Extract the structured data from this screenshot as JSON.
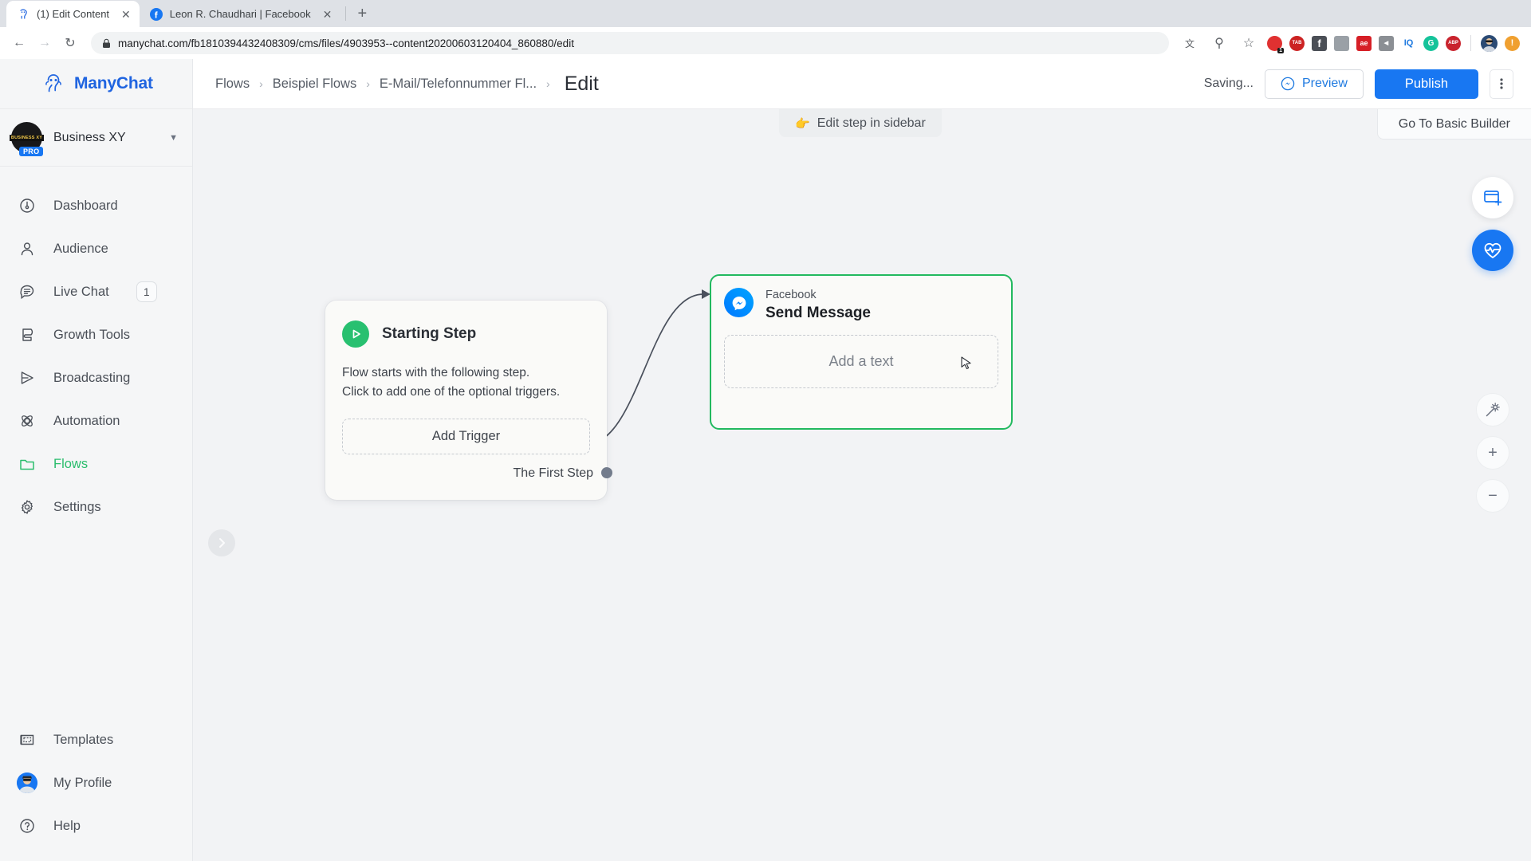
{
  "browser": {
    "tabs": [
      {
        "title": "(1) Edit Content",
        "favicon": "manychat-icon",
        "active": true,
        "close_label": "✕"
      },
      {
        "title": "Leon R. Chaudhari | Facebook",
        "favicon": "facebook-icon",
        "active": false,
        "close_label": "✕"
      }
    ],
    "new_tab_label": "+",
    "back_label": "←",
    "forward_label": "→",
    "reload_label": "↻",
    "url": "manychat.com/fb1810394432408309/cms/files/4903953--content20200603120404_860880/edit",
    "lock_icon": "padlock-icon",
    "toolbar_icons": [
      {
        "name": "translate-icon",
        "label": "文",
        "color": "#5f6368"
      },
      {
        "name": "zoom-search-icon",
        "label": "⚲",
        "color": "#5f6368"
      },
      {
        "name": "bookmark-star-icon",
        "label": "☆",
        "color": "#5f6368"
      }
    ],
    "extensions": [
      {
        "name": "adblock-extension-icon",
        "label": "",
        "color": "#e03131",
        "badge": "1"
      },
      {
        "name": "tab-manager-extension-icon",
        "label": "TAB",
        "color": "#cc2222"
      },
      {
        "name": "facebook-pixel-extension-icon",
        "label": "f",
        "color": "#4b4f56"
      },
      {
        "name": "ghostery-extension-icon",
        "label": "",
        "color": "#9aa0a6"
      },
      {
        "name": "adobe-extension-icon",
        "label": "ae",
        "color": "#d61f26"
      },
      {
        "name": "pocket-extension-icon",
        "label": "◀",
        "color": "#8b8f94"
      },
      {
        "name": "iq-extension-icon",
        "label": "IQ",
        "color": "#1f7ae0"
      },
      {
        "name": "grammarly-extension-icon",
        "label": "G",
        "color": "#15c39a"
      },
      {
        "name": "abp-extension-icon",
        "label": "ABP",
        "color": "#c9232d"
      }
    ],
    "profile_icon": "user-avatar-icon",
    "alert_icon": "update-alert-icon"
  },
  "sidebar": {
    "brand": {
      "name": "ManyChat",
      "logo": "manychat-octopus-logo",
      "color": "#1f64e0"
    },
    "workspace": {
      "avatar_text": "BUSINESS XY",
      "badge": "PRO",
      "name": "Business XY",
      "caret": "⌄"
    },
    "items": [
      {
        "label": "Dashboard",
        "icon": "gauge-icon",
        "active": false
      },
      {
        "label": "Audience",
        "icon": "person-icon",
        "active": false
      },
      {
        "label": "Live Chat",
        "icon": "chat-bubble-icon",
        "active": false,
        "badge": "1"
      },
      {
        "label": "Growth Tools",
        "icon": "magnet-icon",
        "active": false
      },
      {
        "label": "Broadcasting",
        "icon": "paper-plane-icon",
        "active": false
      },
      {
        "label": "Automation",
        "icon": "atom-icon",
        "active": false
      },
      {
        "label": "Flows",
        "icon": "folder-icon",
        "active": true
      },
      {
        "label": "Settings",
        "icon": "gear-icon",
        "active": false
      }
    ],
    "bottom_items": [
      {
        "label": "Templates",
        "icon": "blueprint-icon"
      },
      {
        "label": "My Profile",
        "icon": "profile-avatar-icon"
      },
      {
        "label": "Help",
        "icon": "question-circle-icon"
      }
    ],
    "active_color": "#2bbd6d"
  },
  "topbar": {
    "breadcrumb": [
      {
        "label": "Flows"
      },
      {
        "label": "Beispiel Flows"
      },
      {
        "label": "E-Mail/Telefonnummer Fl..."
      }
    ],
    "separator": "›",
    "current": "Edit",
    "saving_status": "Saving...",
    "preview_label": "Preview",
    "preview_icon": "messenger-preview-icon",
    "publish_label": "Publish",
    "publish_color": "#1877f2",
    "kebab_icon": "more-vertical-icon",
    "basic_builder_label": "Go To Basic Builder"
  },
  "canvas": {
    "edit_tooltip": {
      "icon": "pointing-hand-icon",
      "label": "Edit step in sidebar"
    },
    "collapse_icon": "chevron-right-icon",
    "starting_step": {
      "icon": "play-circle-icon",
      "title": "Starting Step",
      "description_line1": "Flow starts with the following step.",
      "description_line2": "Click to add one of the optional triggers.",
      "add_trigger_label": "Add Trigger",
      "output_label": "The First Step"
    },
    "message_node": {
      "platform": "Facebook",
      "title": "Send Message",
      "icon": "messenger-icon",
      "placeholder": "Add a text",
      "selected": true,
      "selection_color": "#22b95f",
      "toolbar": [
        {
          "name": "duplicate-icon",
          "color": "#3f444c"
        },
        {
          "name": "delete-trash-icon",
          "color": "#e03131"
        }
      ]
    },
    "fab_buttons": [
      {
        "name": "add-card-button",
        "icon": "card-plus-icon",
        "style": "light"
      },
      {
        "name": "flow-health-button",
        "icon": "heart-pulse-icon",
        "style": "blue"
      }
    ],
    "zoom_controls": [
      {
        "name": "auto-arrange-button",
        "icon": "magic-wand-icon",
        "label": ""
      },
      {
        "name": "zoom-in-button",
        "icon": "plus-icon",
        "label": "+"
      },
      {
        "name": "zoom-out-button",
        "icon": "minus-icon",
        "label": "−"
      }
    ]
  }
}
